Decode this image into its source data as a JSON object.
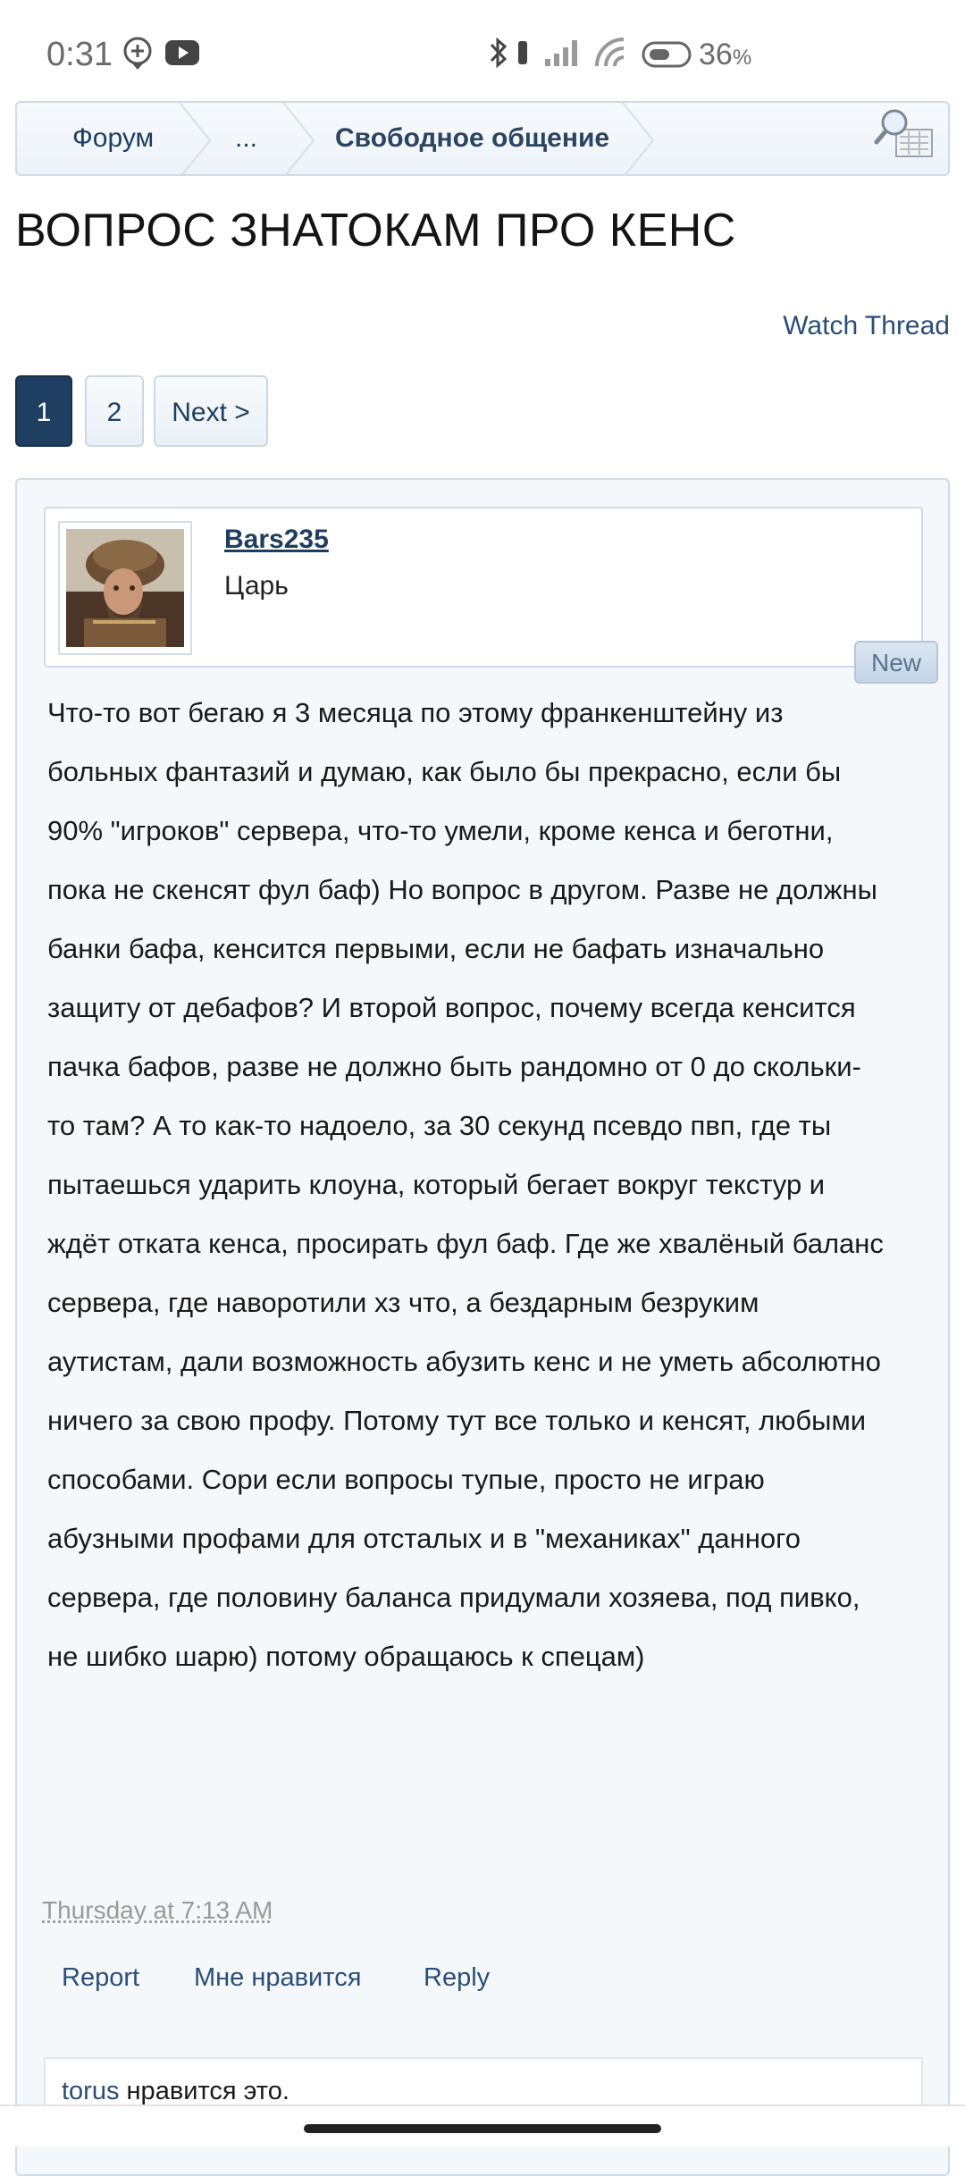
{
  "status_bar": {
    "time": "0:31",
    "battery_value": "36",
    "battery_unit": "%",
    "icons": [
      "location-pin-icon",
      "youtube-icon",
      "bluetooth-icon",
      "vibrate-icon",
      "signal-icon",
      "wifi-icon",
      "battery-icon"
    ]
  },
  "breadcrumb": {
    "items": [
      "Форум",
      "...",
      "Свободное общение"
    ],
    "tool_icon": "search-icon"
  },
  "thread": {
    "title": "ВОПРОС ЗНАТОКАМ ПРО КЕНС",
    "watch_label": "Watch Thread"
  },
  "pagination": {
    "current": "1",
    "pages": [
      "1",
      "2"
    ],
    "next_label": "Next >"
  },
  "post": {
    "username": "Bars235",
    "user_title": "Царь",
    "new_badge": "New",
    "message": "Что-то вот бегаю я 3 месяца по этому франкенштейну из больных фантазий и думаю, как было бы прекрасно, если бы 90% \"игроков\" сервера, что-то умели, кроме кенса и беготни, пока не скенсят фул баф) Но вопрос в другом. Разве не должны банки бафа, кенсится первыми, если не бафать изначально защиту от дебафов? И второй вопрос, почему всегда кенсится пачка бафов, разве не должно быть рандомно от 0 до скольки-то там? А то как-то надоело, за 30 секунд псевдо пвп, где ты пытаешься ударить клоуна, который бегает вокруг текстур и ждёт отката кенса, просирать фул баф. Где же хвалёный баланс сервера, где наворотили хз что, а бездарным безруким аутистам, дали возможность абузить кенс и не уметь абсолютно ничего за свою профу. Потому тут все только и кенсят, любыми способами. Сори если вопросы тупые, просто не играю абузными профами для отсталых и в \"механиках\" данного сервера, где половину баланса придумали хозяева, под пивко, не шибко шарю) потому обращаюсь к спецам)",
    "date": "Thursday at 7:13 AM",
    "actions": {
      "report": "Report",
      "like": "Мне нравится",
      "reply": "Reply"
    },
    "likes": {
      "liker": "torus",
      "suffix": "нравится это."
    }
  },
  "colors": {
    "accent": "#1e3f62",
    "link": "#2a4f77",
    "border": "#cfdbe8",
    "post_bg": "#f5f8fb"
  }
}
